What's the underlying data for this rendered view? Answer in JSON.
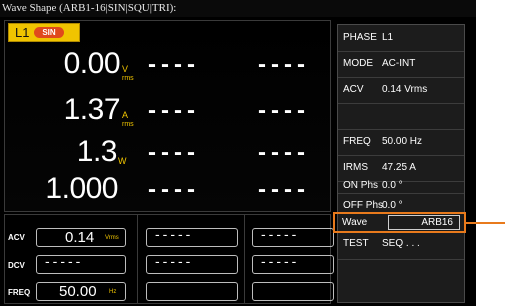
{
  "title": "Wave Shape (ARB1-16|SIN|SQU|TRI):",
  "channel": {
    "label": "L1",
    "wave_badge": "SIN"
  },
  "measurements": [
    {
      "value": "0.00",
      "unit": "V",
      "unit_sub": "rms",
      "dash1": "----",
      "dash2": "----"
    },
    {
      "value": "1.37",
      "unit": "A",
      "unit_sub": "rms",
      "dash1": "----",
      "dash2": "----"
    },
    {
      "value": "1.3",
      "unit": "W",
      "unit_sub": "",
      "dash1": "----",
      "dash2": "----"
    },
    {
      "value": "1.000",
      "unit": "",
      "unit_sub": "",
      "dash1": "----",
      "dash2": "----"
    }
  ],
  "side_panel": [
    {
      "label": "PHASE",
      "value": "L1"
    },
    {
      "label": "MODE",
      "value": "AC-INT"
    },
    {
      "label": "ACV",
      "value": "0.14 Vrms"
    },
    {
      "label": "",
      "value": ""
    },
    {
      "label": "FREQ",
      "value": "50.00 Hz"
    },
    {
      "label": "IRMS",
      "value": "47.25 A"
    },
    {
      "label": "ON Phs",
      "value": "0.0 °"
    },
    {
      "label": "OFF Phs",
      "value": "0.0 °"
    },
    {
      "label": "Wave",
      "value": "ARB16"
    },
    {
      "label": "TEST",
      "value": "SEQ . . ."
    },
    {
      "label": "",
      "value": ""
    }
  ],
  "settings": [
    {
      "label": "ACV",
      "value": "0.14",
      "unit": "Vrms",
      "dash2": "-----",
      "dash3": "-----"
    },
    {
      "label": "DCV",
      "value": "-----",
      "unit": "",
      "dash2": "-----",
      "dash3": "-----"
    },
    {
      "label": "FREQ",
      "value": "50.00",
      "unit": "Hz",
      "dash2": "",
      "dash3": ""
    }
  ],
  "colors": {
    "accent": "#f0c400",
    "highlight": "#e87a1c",
    "badge": "#e0491c"
  }
}
